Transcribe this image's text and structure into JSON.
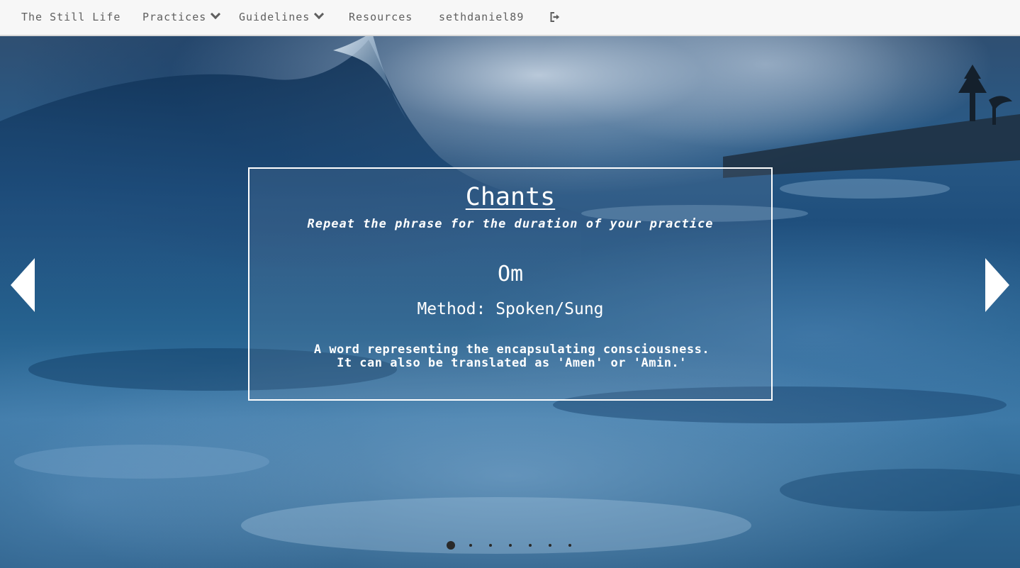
{
  "nav": {
    "brand": "The Still Life",
    "practices": "Practices",
    "guidelines": "Guidelines",
    "resources": "Resources",
    "username": "sethdaniel89",
    "logout_icon": "sign-out-icon"
  },
  "card": {
    "title": "Chants",
    "subtitle": "Repeat the phrase for the duration of your practice",
    "chant_name": "Om",
    "method": "Method: Spoken/Sung",
    "description": "A word representing the encapsulating consciousness. It can also be translated as 'Amen' or 'Amin.'"
  },
  "carousel": {
    "prev_icon": "triangle-left-icon",
    "next_icon": "triangle-right-icon",
    "slide_count": 7,
    "active_slide": 1
  },
  "colors": {
    "nav_background": "#f7f7f7",
    "nav_text": "#5f5f5f",
    "card_border": "#ffffff",
    "card_text": "#ffffff",
    "ocean_deep": "#1f4f7d",
    "dot": "#2a2a2a"
  }
}
